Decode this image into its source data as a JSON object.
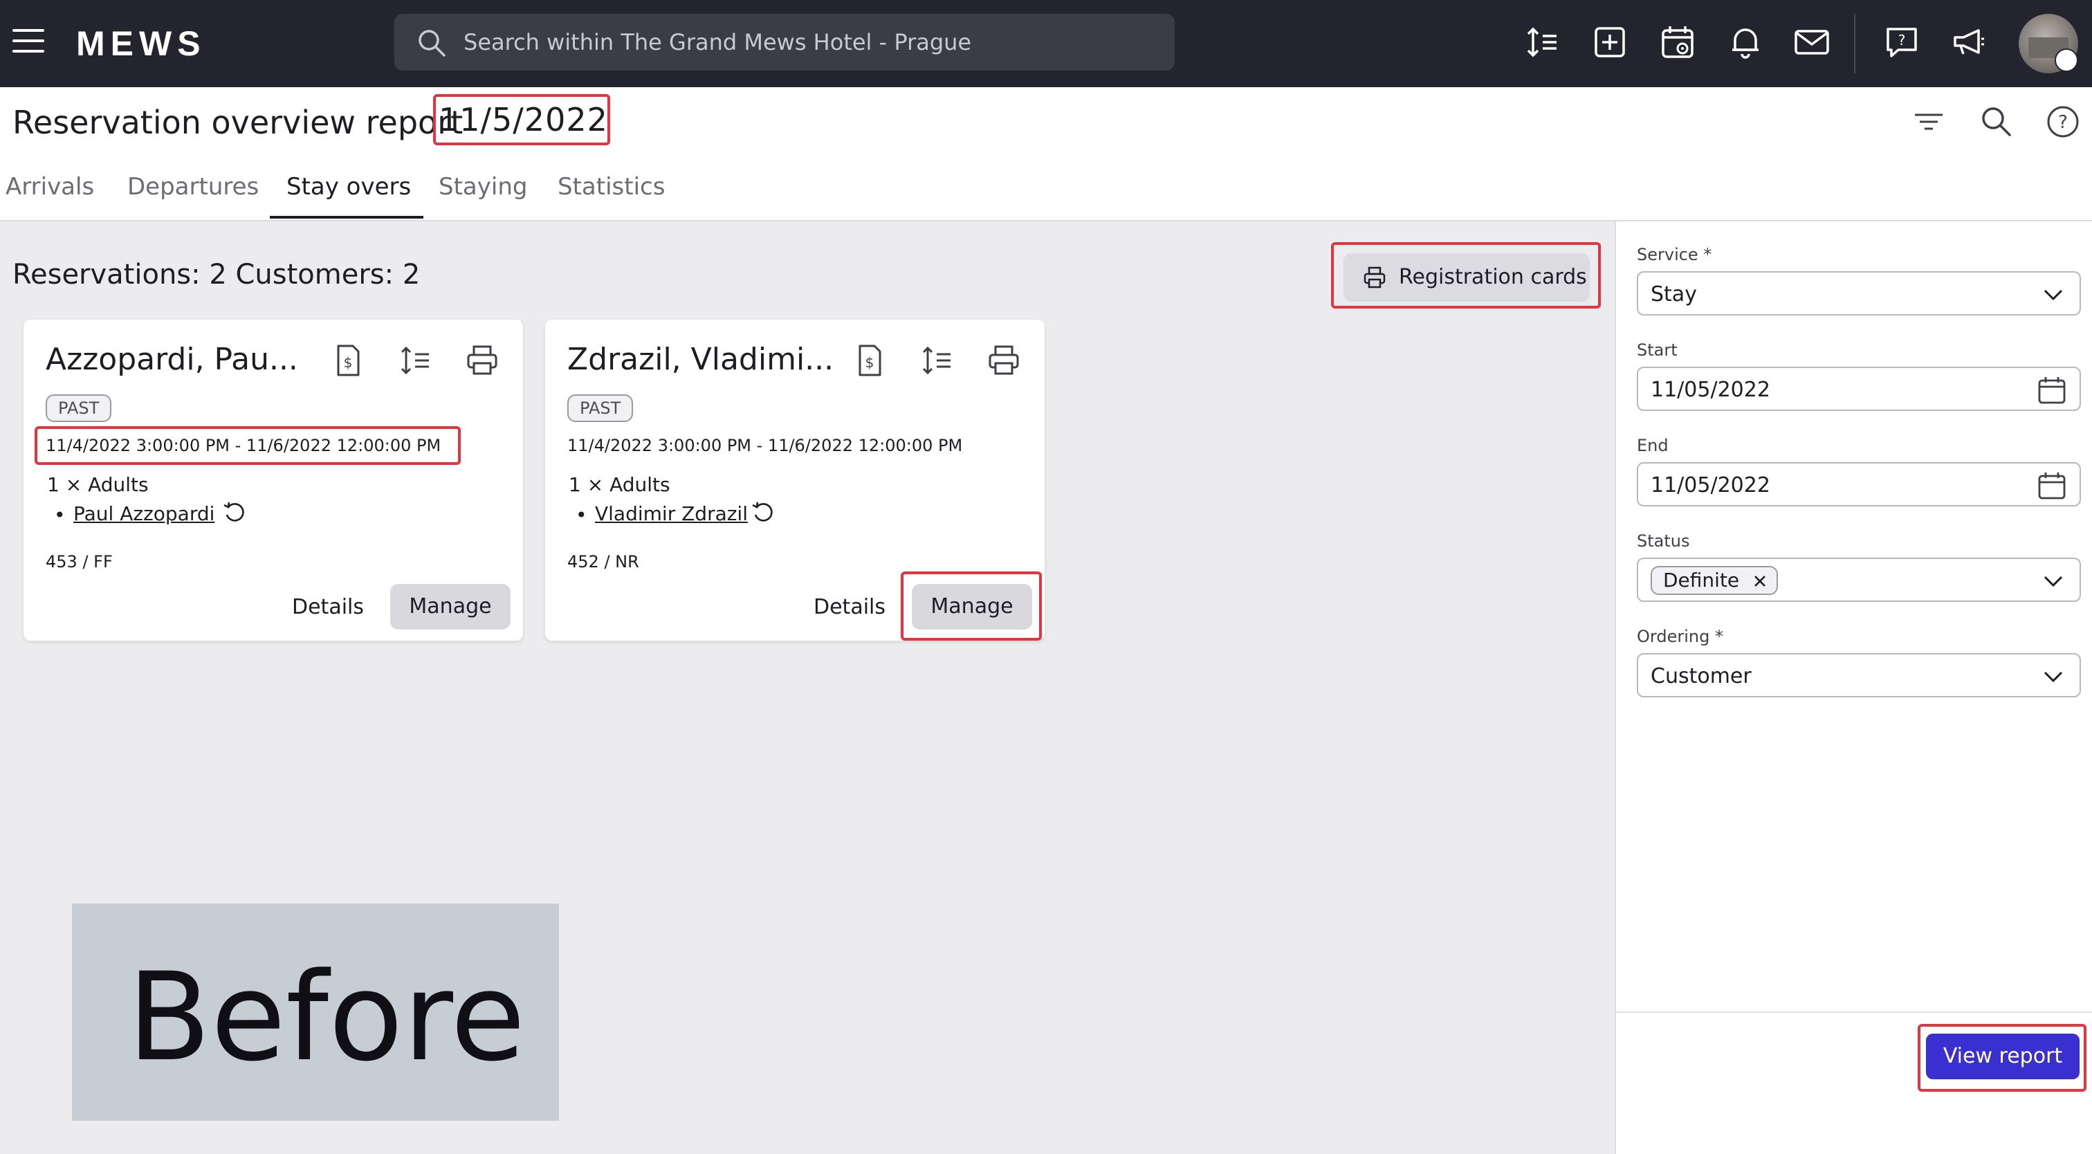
{
  "topbar": {
    "brand": "MEWS",
    "search_placeholder": "Search within The Grand Mews Hotel - Prague",
    "icons": [
      "menu-icon",
      "sort-icon",
      "add-icon",
      "calendar-icon",
      "bell-icon",
      "mail-icon",
      "help-chat-icon",
      "megaphone-icon",
      "avatar"
    ]
  },
  "header": {
    "title": "Reservation overview report",
    "date": "11/5/2022",
    "tabs": [
      "Arrivals",
      "Departures",
      "Stay overs",
      "Staying",
      "Statistics"
    ],
    "active_tab": "Stay overs"
  },
  "summary": "Reservations: 2 Customers: 2",
  "registration_cards_label": "Registration cards",
  "cards": [
    {
      "name": "Azzopardi, Pau...",
      "badge": "PAST",
      "dates": "11/4/2022 3:00:00 PM - 11/6/2022 12:00:00 PM",
      "adults": "1 × Adults",
      "guest": "Paul Azzopardi",
      "room": "453 / FF",
      "details_label": "Details",
      "manage_label": "Manage"
    },
    {
      "name": "Zdrazil, Vladimi...",
      "badge": "PAST",
      "dates": "11/4/2022 3:00:00 PM - 11/6/2022 12:00:00 PM",
      "adults": "1 × Adults",
      "guest": "Vladimir Zdrazil",
      "room": "452 / NR",
      "details_label": "Details",
      "manage_label": "Manage"
    }
  ],
  "overlay_label": "Before",
  "filters": {
    "service_label": "Service *",
    "service_value": "Stay",
    "start_label": "Start",
    "start_value": "11/05/2022",
    "end_label": "End",
    "end_value": "11/05/2022",
    "status_label": "Status",
    "status_chip": "Definite",
    "ordering_label": "Ordering *",
    "ordering_value": "Customer",
    "view_report_label": "View report"
  },
  "colors": {
    "topbar": "#24242f",
    "highlight": "#e5333f",
    "primary": "#3a2fd1"
  }
}
